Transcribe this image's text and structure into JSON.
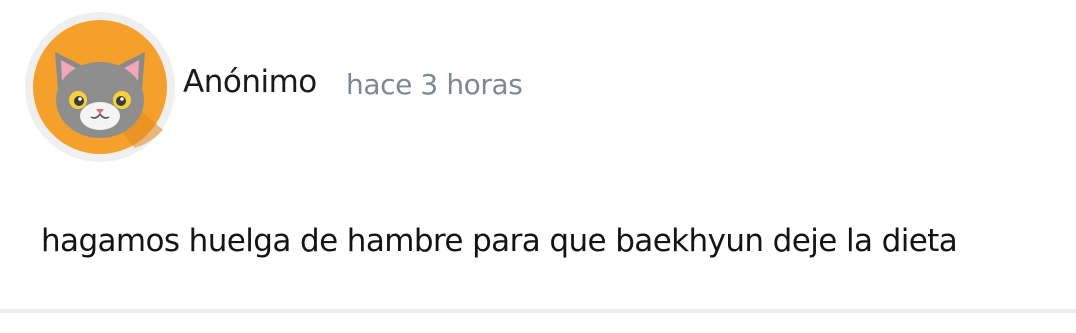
{
  "post": {
    "author": "Anónimo",
    "timestamp": "hace 3 horas",
    "body": "hagamos huelga de hambre para que baekhyun deje la dieta"
  },
  "avatar": {
    "icon": "cat-face-icon",
    "background_color": "#f5a02b",
    "ring_color": "#efefef"
  }
}
